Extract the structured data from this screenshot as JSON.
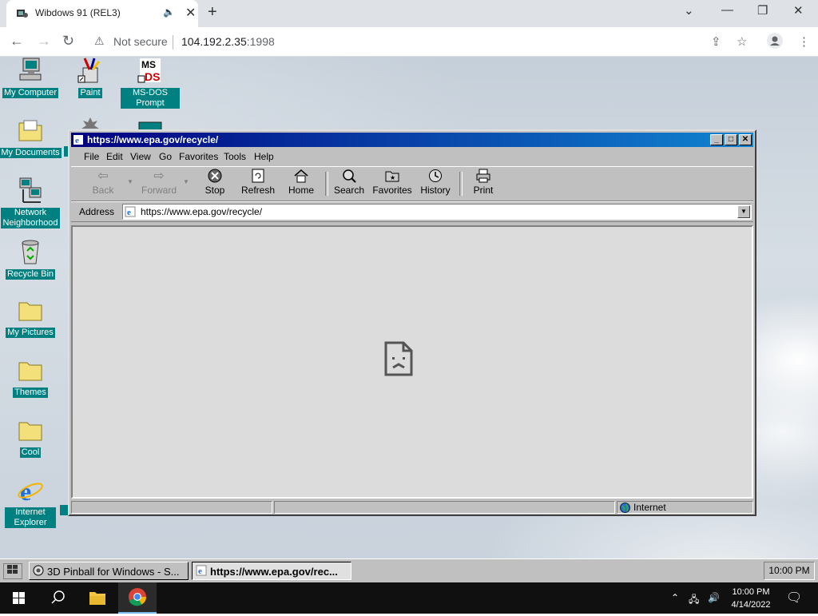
{
  "chrome": {
    "tab_title": "Wibdows 91 (REL3)",
    "tab_close": "✕",
    "new_tab": "+",
    "not_secure": "Not secure",
    "url_host": "104.192.2.35",
    "url_port": ":1998",
    "window_controls": {
      "chevron": "⌄",
      "minimize": "—",
      "restore": "❐",
      "close": "✕"
    }
  },
  "desktop": {
    "icons": [
      {
        "label": "My Computer",
        "icon": "computer-icon"
      },
      {
        "label": "Paint",
        "icon": "paint-icon"
      },
      {
        "label": "MS-DOS Prompt",
        "icon": "msdos-icon"
      },
      {
        "label": "My Documents",
        "icon": "folder-icon"
      },
      {
        "label": "Network Neighborhood",
        "icon": "network-icon"
      },
      {
        "label": "Recycle Bin",
        "icon": "recycle-bin-icon"
      },
      {
        "label": "My Pictures",
        "icon": "folder-icon"
      },
      {
        "label": "Themes",
        "icon": "folder-icon"
      },
      {
        "label": "Cool",
        "icon": "folder-icon"
      },
      {
        "label": "Internet Explorer",
        "icon": "ie-icon"
      }
    ]
  },
  "ie": {
    "title": "https://www.epa.gov/recycle/",
    "title_buttons": {
      "minimize": "_",
      "maximize": "□",
      "close": "✕"
    },
    "menu": [
      "File",
      "Edit",
      "View",
      "Go",
      "Favorites",
      "Tools",
      "Help"
    ],
    "toolbar": {
      "back": "Back",
      "forward": "Forward",
      "stop": "Stop",
      "refresh": "Refresh",
      "home": "Home",
      "search": "Search",
      "favorites": "Favorites",
      "history": "History",
      "print": "Print"
    },
    "address_label": "Address",
    "address_value": "https://www.epa.gov/recycle/",
    "status_zone": "Internet"
  },
  "taskbar98": {
    "tasks": [
      "3D Pinball for Windows - S...",
      "https://www.epa.gov/rec..."
    ],
    "clock": "10:00 PM"
  },
  "hostbar": {
    "time": "10:00 PM",
    "date": "4/14/2022"
  },
  "colors": {
    "title_bar_start": "#000080",
    "title_bar_end": "#1084d0",
    "icon_label_bg": "#008080",
    "win98_face": "#c0c0c0"
  }
}
